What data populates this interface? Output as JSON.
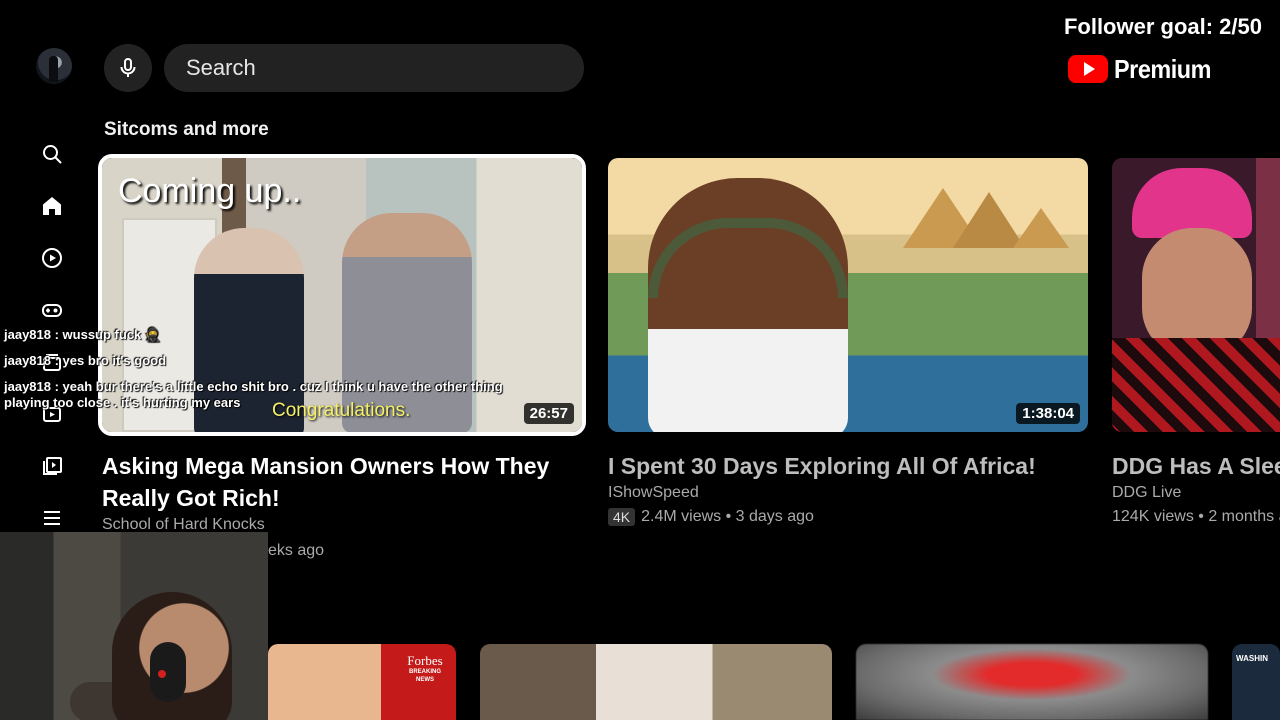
{
  "overlay": {
    "follower_goal": "Follower goal: 2/50",
    "premium_label": "Premium"
  },
  "search": {
    "placeholder": "Search"
  },
  "section": {
    "title": "Sitcoms and more"
  },
  "videos": [
    {
      "title": "Asking Mega Mansion Owners How They Really Got Rich!",
      "channel": "School of Hard Knocks",
      "meta": "eks ago",
      "duration": "26:57",
      "thumb_overlay_top": "Coming up..",
      "thumb_caption": "Congratulations."
    },
    {
      "title": "I Spent 30 Days Exploring All Of Africa!",
      "channel": "IShowSpeed",
      "badge": "4K",
      "meta": "2.4M views • 3 days ago",
      "duration": "1:38:04"
    },
    {
      "title": "DDG Has A Slee",
      "channel": "DDG Live",
      "meta": "124K views • 2 months a"
    }
  ],
  "chat": [
    {
      "text": "jaay818 : wussup fuck 🥷"
    },
    {
      "text": "jaay818 : yes bro it's good"
    },
    {
      "text": "jaay818 : yeah bur there's a little echo shit bro . cuz I think u have the other thing"
    },
    {
      "text": "playing too close . it's hurting my ears"
    }
  ],
  "bottom_row": {
    "forbes_logo": "Forbes",
    "forbes_tag": "BREAKING NEWS",
    "card4_label": "WASHIN"
  },
  "colors": {
    "background": "#000000",
    "search_bg": "#222222",
    "youtube_red": "#ff0000",
    "caption_yellow": "#f4f168"
  }
}
